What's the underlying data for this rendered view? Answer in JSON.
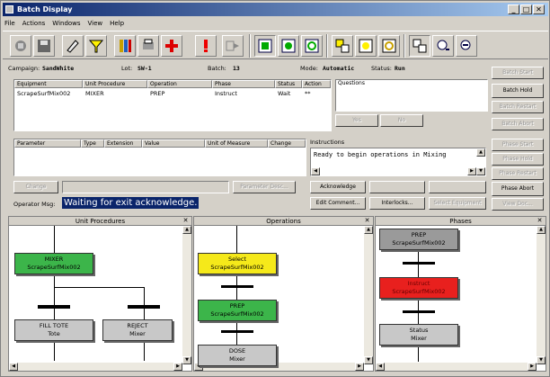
{
  "window": {
    "title": "Batch Display",
    "minimize": "_",
    "restore": "□",
    "close": "✕"
  },
  "menu": [
    "File",
    "Actions",
    "Windows",
    "View",
    "Help"
  ],
  "toolbar": {
    "icons": [
      "home-icon",
      "save-icon",
      "edit-icon",
      "filter-icon",
      "book-icon",
      "print-icon",
      "add-icon",
      "alert-icon",
      "export-icon",
      "view-1-icon",
      "view-2-icon",
      "view-3-icon",
      "view-4-icon",
      "view-5-icon",
      "view-6-icon",
      "view-7-icon",
      "zoom-in-icon",
      "zoom-out-icon"
    ]
  },
  "batch": {
    "campaign_label": "Campaign:",
    "campaign": "SandWhite",
    "lot_label": "Lot:",
    "lot": "SW-1",
    "batch_label": "Batch:",
    "batch": "13",
    "mode_label": "Mode:",
    "mode": "Automatic",
    "status_label": "Status:",
    "status": "Run"
  },
  "equipment_table": {
    "headers": [
      "Equipment",
      "Unit Procedure",
      "Operation",
      "Phase",
      "Status",
      "Action"
    ],
    "rows": [
      [
        "ScrapeSurfMix002",
        "MIXER",
        "PREP",
        "Instruct",
        "Wait",
        "**"
      ]
    ]
  },
  "questions": {
    "header": "Questions",
    "yes": "Yes",
    "no": "No"
  },
  "batch_buttons": {
    "start": "Batch Start",
    "hold": "Batch Hold",
    "restart": "Batch Restart",
    "abort": "Batch Abort"
  },
  "param_table": {
    "headers": [
      "Parameter",
      "Type",
      "Extension",
      "Value",
      "Unit of Measure",
      "Change"
    ]
  },
  "instructions": {
    "label": "Instructions",
    "text": "Ready to begin operations in Mixing"
  },
  "phase_buttons": {
    "start": "Phase Start",
    "hold": "Phase Hold",
    "restart": "Phase Restart",
    "abort": "Phase Abort",
    "view_doc": "View Doc..."
  },
  "action_buttons": {
    "change": "Change",
    "param_desc": "Parameter Desc...",
    "acknowledge": "Acknowledge",
    "edit_comment": "Edit Comment...",
    "interlocks": "Interlocks...",
    "select_equipment": "Select Equipment"
  },
  "operator_msg": {
    "label": "Operator Msg:",
    "text": "Waiting for exit acknowledge."
  },
  "panes": {
    "unit_procedures": {
      "title": "Unit Procedures",
      "nodes": [
        {
          "l1": "MIXER",
          "l2": "ScrapeSurfMix002",
          "color": "#3cb54a"
        },
        {
          "l1": "FILL TOTE",
          "l2": "Tote",
          "color": "#c8c8c8"
        },
        {
          "l1": "REJECT",
          "l2": "Mixer",
          "color": "#c8c8c8"
        }
      ]
    },
    "operations": {
      "title": "Operations",
      "nodes": [
        {
          "l1": "Select",
          "l2": "ScrapeSurfMix002",
          "color": "#f5e91a"
        },
        {
          "l1": "PREP",
          "l2": "ScrapeSurfMix002",
          "color": "#3cb54a"
        },
        {
          "l1": "DOSE",
          "l2": "Mixer",
          "color": "#c8c8c8"
        }
      ]
    },
    "phases": {
      "title": "Phases",
      "nodes": [
        {
          "l1": "PREP",
          "l2": "ScrapeSurfMix002",
          "color": "#9a9a9a"
        },
        {
          "l1": "Instruct",
          "l2": "ScrapeSurfMix002",
          "color": "#e8201e"
        },
        {
          "l1": "Status",
          "l2": "Mixer",
          "color": "#c8c8c8"
        }
      ]
    }
  }
}
